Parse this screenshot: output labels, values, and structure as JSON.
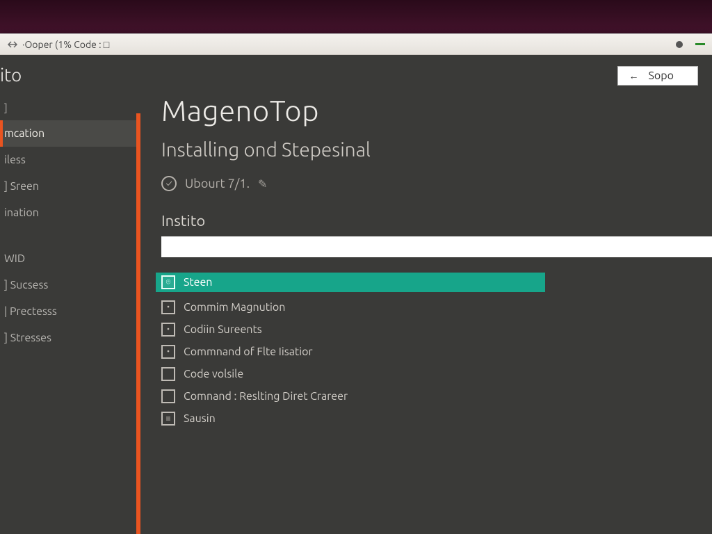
{
  "window": {
    "title": "·Ooper (1% Code : □"
  },
  "topPill": {
    "label": "Sopo"
  },
  "sidebar": {
    "brand": "ito",
    "items": [
      {
        "label": "]"
      },
      {
        "label": "mcation",
        "active": true
      },
      {
        "label": "iless"
      },
      {
        "label": "] Sreen"
      },
      {
        "label": "ination"
      }
    ],
    "group2": [
      {
        "label": "WID"
      },
      {
        "label": "] Sucsess"
      },
      {
        "label": "| Prectesss"
      },
      {
        "label": "] Stresses"
      }
    ]
  },
  "main": {
    "title": "MagenoTop",
    "subtitle": "Installing ond Stepesinal",
    "meta": "Ubourt 7/1.",
    "sectionLabel": "Instito",
    "rows": [
      {
        "label": "Steen",
        "highlight": true,
        "icon": "badge"
      },
      {
        "label": "Commim Magnution",
        "icon": "dot"
      },
      {
        "label": "Codiin Sureents",
        "icon": "dot"
      },
      {
        "label": "Commnand of Flte Iisatior",
        "icon": "dot"
      },
      {
        "label": "Code volsile",
        "icon": "empty"
      },
      {
        "label": "Comnand : Reslting Diret Crareer",
        "icon": "empty"
      },
      {
        "label": "Sausin",
        "icon": "lines"
      }
    ]
  }
}
